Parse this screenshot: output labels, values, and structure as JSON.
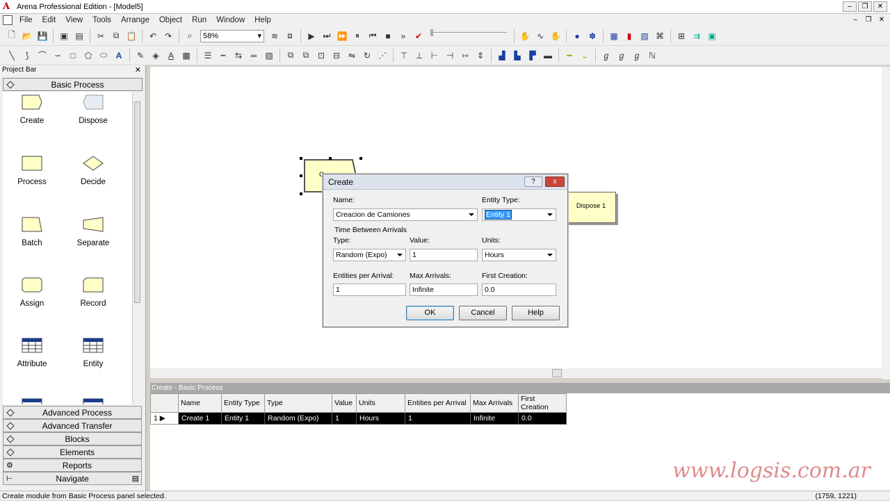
{
  "window": {
    "title": "Arena Professional Edition - [Model5]",
    "app_letter": "A"
  },
  "menu": [
    "File",
    "Edit",
    "View",
    "Tools",
    "Arrange",
    "Object",
    "Run",
    "Window",
    "Help"
  ],
  "toolbar": {
    "zoom": "58%"
  },
  "project_bar": {
    "title": "Project Bar",
    "active_panel": "Basic Process",
    "modules": [
      "Create",
      "Dispose",
      "Process",
      "Decide",
      "Batch",
      "Separate",
      "Assign",
      "Record",
      "Attribute",
      "Entity"
    ],
    "other_panels": [
      "Advanced Process",
      "Advanced Transfer",
      "Blocks",
      "Elements",
      "Reports",
      "Navigate"
    ]
  },
  "canvas": {
    "create_module_label": "C",
    "dispose_module_label": "Dispose 1"
  },
  "dialog": {
    "title": "Create",
    "help_btn": "?",
    "close_btn": "x",
    "name_label": "Name:",
    "name_value": "Creacion de Camiones",
    "entity_type_label": "Entity Type:",
    "entity_type_value": "Entity 1",
    "tba_group": "Time Between Arrivals",
    "type_label": "Type:",
    "type_value": "Random (Expo)",
    "value_label": "Value:",
    "value_value": "1",
    "units_label": "Units:",
    "units_value": "Hours",
    "epa_label": "Entities per Arrival:",
    "epa_value": "1",
    "max_label": "Max Arrivals:",
    "max_value": "Infinite",
    "first_label": "First Creation:",
    "first_value": "0.0",
    "ok": "OK",
    "cancel": "Cancel",
    "help": "Help"
  },
  "sheet": {
    "title": "Create - Basic Process",
    "columns": [
      "Name",
      "Entity Type",
      "Type",
      "Value",
      "Units",
      "Entities per Arrival",
      "Max Arrivals",
      "First Creation"
    ],
    "row_num": "1",
    "row": [
      "Create 1",
      "Entity 1",
      "Random (Expo)",
      "1",
      "Hours",
      "1",
      "Infinite",
      "0.0"
    ]
  },
  "status": {
    "message": "Create module from Basic Process panel selected.",
    "coords": "(1759, 1221)"
  },
  "watermark": "www.logsis.com.ar"
}
